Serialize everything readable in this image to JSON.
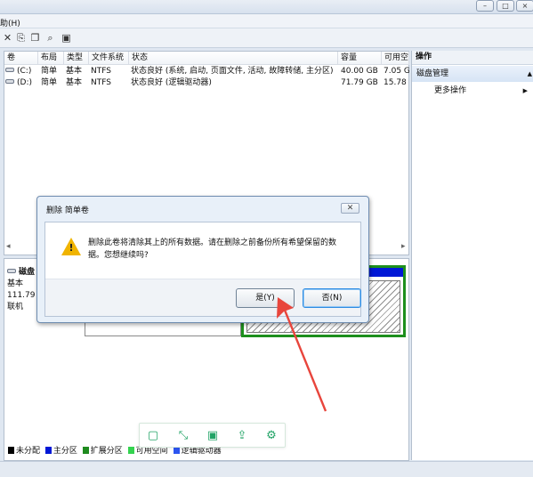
{
  "window": {
    "minimize_glyph": "–",
    "maximize_glyph": "□",
    "close_glyph": "×"
  },
  "menu": {
    "help_label": "助(H)"
  },
  "toolbar": {
    "icons": [
      "close-x-icon",
      "properties-icon",
      "folder-open-icon",
      "search-icon",
      "help-panel-icon"
    ],
    "glyphs": [
      "✕",
      "⎘",
      "❐",
      "⌕",
      "▣"
    ]
  },
  "volume_table": {
    "headers": [
      "卷",
      "布局",
      "类型",
      "文件系统",
      "状态",
      "容量",
      "可用空"
    ],
    "rows": [
      {
        "volume": "(C:)",
        "layout": "简单",
        "type": "基本",
        "fs": "NTFS",
        "status": "状态良好 (系统, 启动, 页面文件, 活动, 故障转储, 主分区)",
        "capacity": "40.00 GB",
        "free": "7.05 G"
      },
      {
        "volume": "(D:)",
        "layout": "简单",
        "type": "基本",
        "fs": "NTFS",
        "status": "状态良好 (逻辑驱动器)",
        "capacity": "71.79 GB",
        "free": "15.78"
      }
    ]
  },
  "actions": {
    "header": "操作",
    "group": "磁盘管理",
    "more": "更多操作",
    "group_collapse_glyph": "▲",
    "more_arrow_glyph": "▶"
  },
  "disk": {
    "name": "磁盘",
    "type": "基本",
    "size": "111.79",
    "status": "联机"
  },
  "legend": [
    {
      "label": "未分配",
      "color": "#000000"
    },
    {
      "label": "主分区",
      "color": "#0018d6"
    },
    {
      "label": "扩展分区",
      "color": "#1f8b1f"
    },
    {
      "label": "可用空间",
      "color": "#34d34f"
    },
    {
      "label": "逻辑驱动器",
      "color": "#2c55f0"
    }
  ],
  "dialog": {
    "title": "删除 简单卷",
    "message": "删除此卷将清除其上的所有数据。请在删除之前备份所有希望保留的数据。您想继续吗?",
    "yes_label": "是(Y)",
    "no_label": "否(N)",
    "close_glyph": "✕",
    "warning_mark": "!"
  },
  "floating_toolbar": {
    "icons": [
      "tablet-icon",
      "expand-icon",
      "save-icon",
      "share-icon",
      "settings-icon"
    ],
    "glyphs": [
      "▢",
      "⤡",
      "▣",
      "⇪",
      "⚙"
    ]
  },
  "annotation": {
    "arrow_color": "#e8453c"
  }
}
